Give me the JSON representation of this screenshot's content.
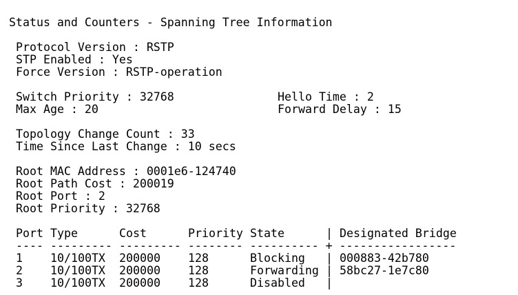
{
  "title": "Status and Counters - Spanning Tree Information",
  "protocol": {
    "protocol_version": "Protocol Version : RSTP",
    "stp_enabled": "STP Enabled : Yes",
    "force_version": "Force Version : RSTP-operation"
  },
  "timers": {
    "switch_priority": "Switch Priority : 32768",
    "hello_time": "Hello Time : 2",
    "max_age": "Max Age : 20",
    "forward_delay": "Forward Delay : 15"
  },
  "topology": {
    "change_count": "Topology Change Count : 33",
    "time_since_change": "Time Since Last Change : 10 secs"
  },
  "root": {
    "mac_address": "Root MAC Address : 0001e6-124740",
    "path_cost": "Root Path Cost : 200019",
    "port": "Root Port : 2",
    "priority": "Root Priority : 32768"
  },
  "port_table": {
    "headers": {
      "port": "Port",
      "type": "Type",
      "cost": "Cost",
      "priority": "Priority",
      "state": "State",
      "separator": "|",
      "designated_bridge": "Designated Bridge"
    },
    "divider": "---- --------- --------- -------- ---------- + -----------------",
    "rows": [
      {
        "port": "1",
        "type": "10/100TX",
        "cost": "200000",
        "priority": "128",
        "state": "Blocking",
        "separator": "|",
        "designated_bridge": "000883-42b780"
      },
      {
        "port": "2",
        "type": "10/100TX",
        "cost": "200000",
        "priority": "128",
        "state": "Forwarding",
        "separator": "|",
        "designated_bridge": "58bc27-1e7c80"
      },
      {
        "port": "3",
        "type": "10/100TX",
        "cost": "200000",
        "priority": "128",
        "state": "Disabled",
        "separator": "|",
        "designated_bridge": ""
      }
    ]
  }
}
